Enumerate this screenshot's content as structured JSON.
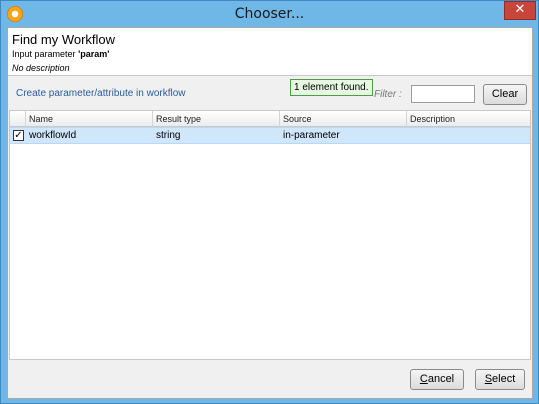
{
  "window": {
    "title": "Chooser...",
    "close_glyph": "✕"
  },
  "header": {
    "heading": "Find my Workflow",
    "input_parameter_label": "Input parameter",
    "parameter_name": "'param'",
    "description": "No description"
  },
  "toolbar": {
    "create_link": "Create parameter/attribute in workflow",
    "found_badge": "1 element found.",
    "filter_label": "Filter :",
    "filter_value": "",
    "clear_label": "Clear"
  },
  "table": {
    "columns": [
      "Name",
      "Result type",
      "Source",
      "Description"
    ],
    "rows": [
      {
        "checked": "✓",
        "name": "workflowId",
        "result_type": "string",
        "source": "in-parameter",
        "description": ""
      }
    ]
  },
  "footer": {
    "cancel_mnemonic": "C",
    "cancel_rest": "ancel",
    "select_mnemonic": "S",
    "select_rest": "elect"
  },
  "colors": {
    "titlebar": "#6fb7e6",
    "selected_row": "#cfe6fb",
    "link": "#2a5c9a",
    "close_button": "#c7453b"
  }
}
